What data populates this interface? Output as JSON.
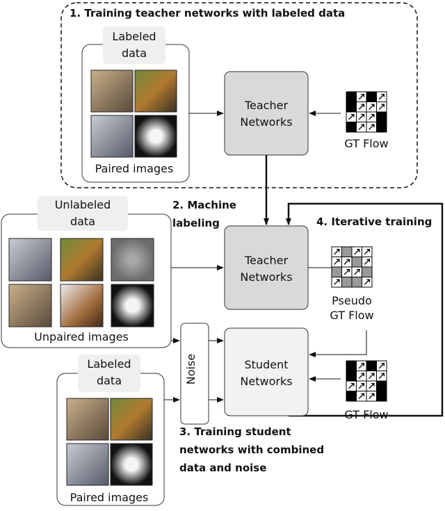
{
  "stage1": {
    "title": "1. Training teacher networks with labeled data",
    "data_tab": [
      "Labeled",
      "data"
    ],
    "caption": "Paired images",
    "teacher": [
      "Teacher",
      "Networks"
    ],
    "gt_label": "GT Flow"
  },
  "stage2": {
    "title": [
      "2. Machine",
      "labeling"
    ],
    "data_tab": [
      "Unlabeled",
      "data"
    ],
    "caption": "Unpaired images",
    "teacher": [
      "Teacher",
      "Networks"
    ],
    "pseudo_label": [
      "Pseudo",
      "GT Flow"
    ]
  },
  "stage3": {
    "title": [
      "3. Training student",
      "networks with combined",
      "data and noise"
    ],
    "data_tab": [
      "Labeled",
      "data"
    ],
    "caption": "Paired images",
    "noise": "Noise",
    "student": [
      "Student",
      "Networks"
    ],
    "gt_label": "GT Flow"
  },
  "stage4": {
    "title": "4. Iterative training"
  },
  "grids": {
    "gt": [
      "BABA",
      "BAAA",
      "AAAB",
      "BAAB"
    ],
    "pseudo": [
      "AGAA",
      "AAGA",
      "GAAG",
      "AGGA"
    ]
  },
  "colors": {
    "teacher_fill": "#d9d9d9",
    "student_fill": "#f2f2f2",
    "tab_fill": "#efefef"
  }
}
